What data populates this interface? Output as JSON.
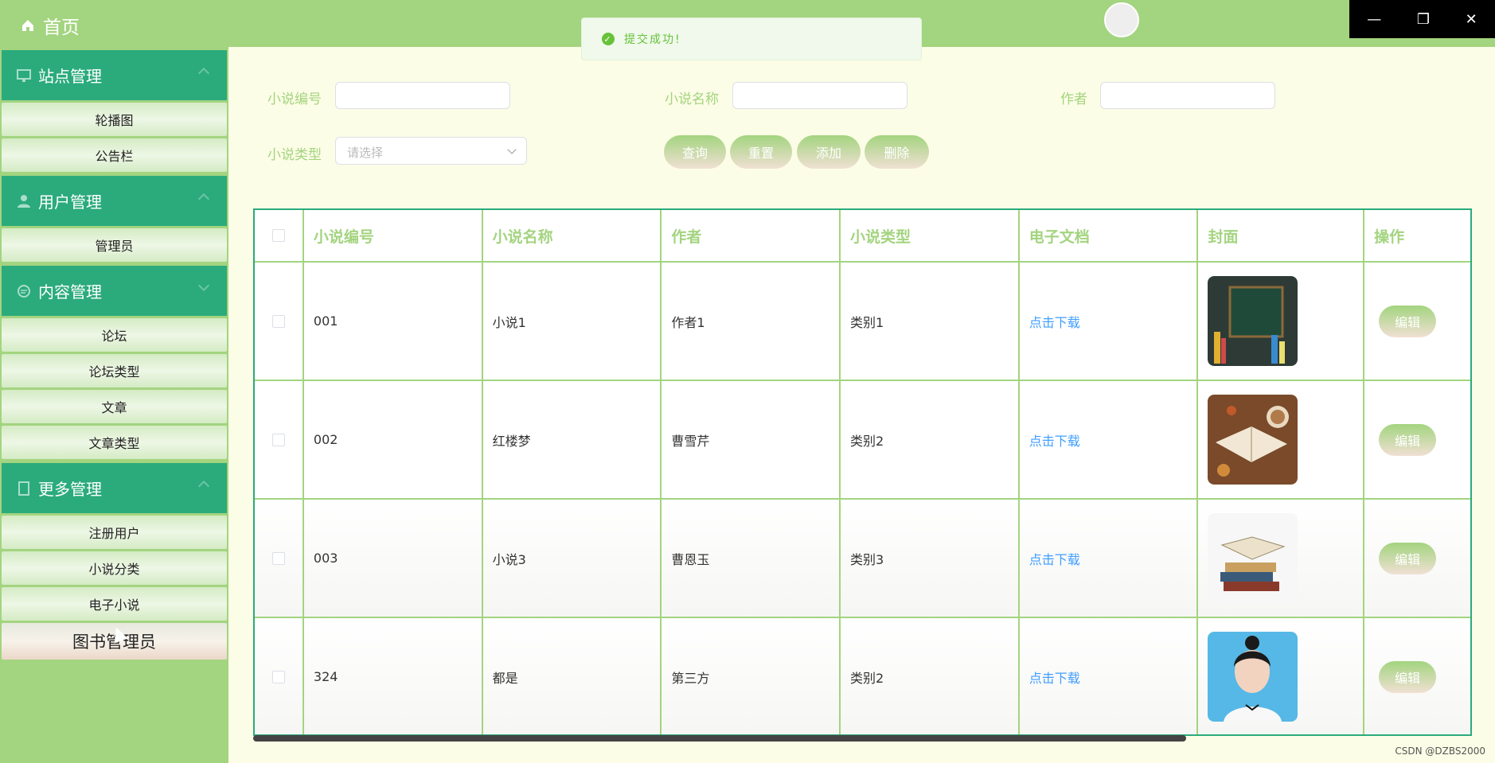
{
  "sidebar": {
    "home": "首页",
    "groups": [
      {
        "title": "站点管理",
        "items": [
          "轮播图",
          "公告栏"
        ]
      },
      {
        "title": "用户管理",
        "items": [
          "管理员"
        ]
      },
      {
        "title": "内容管理",
        "items": [
          "论坛",
          "论坛类型",
          "文章",
          "文章类型"
        ]
      },
      {
        "title": "更多管理",
        "items": [
          "注册用户",
          "小说分类",
          "电子小说",
          "图书管理员"
        ]
      }
    ]
  },
  "toast": {
    "message": "提交成功!"
  },
  "search": {
    "id_label": "小说编号",
    "name_label": "小说名称",
    "author_label": "作者",
    "type_label": "小说类型",
    "type_placeholder": "请选择",
    "buttons": {
      "query": "查询",
      "reset": "重置",
      "add": "添加",
      "delete": "删除"
    }
  },
  "table": {
    "headers": [
      "小说编号",
      "小说名称",
      "作者",
      "小说类型",
      "电子文档",
      "封面",
      "操作"
    ],
    "rows": [
      {
        "id": "001",
        "name": "小说1",
        "author": "作者1",
        "type": "类别1",
        "doc": "点击下载",
        "cover": "blackboard",
        "action": "编辑"
      },
      {
        "id": "002",
        "name": "红楼梦",
        "author": "曹雪芹",
        "type": "类别2",
        "doc": "点击下载",
        "cover": "book-and-coffee",
        "action": "编辑"
      },
      {
        "id": "003",
        "name": "小说3",
        "author": "曹恩玉",
        "type": "类别3",
        "doc": "点击下载",
        "cover": "stack-of-books",
        "action": "编辑"
      },
      {
        "id": "324",
        "name": "都是",
        "author": "第三方",
        "type": "类别2",
        "doc": "点击下载",
        "cover": "portrait",
        "action": "编辑"
      }
    ]
  },
  "footer": {
    "watermark": "CSDN @DZBS2000"
  },
  "colors": {
    "primary": "#a3d47f",
    "accent": "#2bab7c",
    "link": "#409eff",
    "success": "#67c23a"
  }
}
